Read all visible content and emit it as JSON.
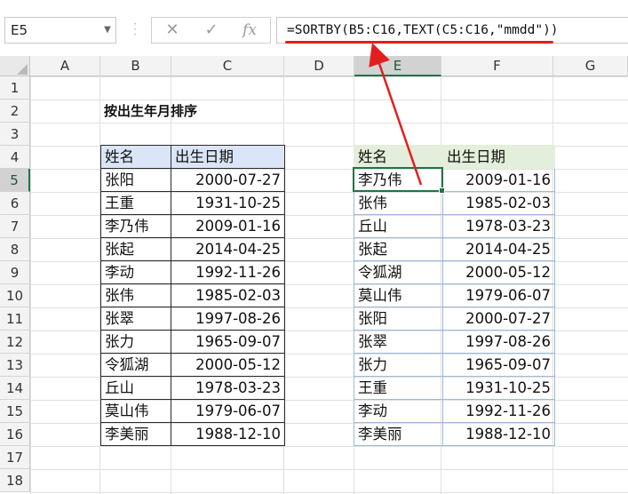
{
  "name_box": "E5",
  "formula": "=SORTBY(B5:C16,TEXT(C5:C16,\"mmdd\"))",
  "formula_icons": [
    "cancel-icon",
    "enter-icon",
    "function-icon"
  ],
  "fx_label": "fx",
  "columns": [
    "A",
    "B",
    "C",
    "D",
    "E",
    "F",
    "G"
  ],
  "rows": [
    "1",
    "2",
    "3",
    "4",
    "5",
    "6",
    "7",
    "8",
    "9",
    "10",
    "11",
    "12",
    "13",
    "14",
    "15",
    "16",
    "17",
    "18"
  ],
  "selected_column": "E",
  "selected_row": "5",
  "sheet_title": "按出生年月排序",
  "left_table": {
    "headers": [
      "姓名",
      "出生日期"
    ],
    "rows": [
      [
        "张阳",
        "2000-07-27"
      ],
      [
        "王重",
        "1931-10-25"
      ],
      [
        "李乃伟",
        "2009-01-16"
      ],
      [
        "张起",
        "2014-04-25"
      ],
      [
        "李动",
        "1992-11-26"
      ],
      [
        "张伟",
        "1985-02-03"
      ],
      [
        "张翠",
        "1997-08-26"
      ],
      [
        "张力",
        "1965-09-07"
      ],
      [
        "令狐湖",
        "2000-05-12"
      ],
      [
        "丘山",
        "1978-03-23"
      ],
      [
        "莫山伟",
        "1979-06-07"
      ],
      [
        "李美丽",
        "1988-12-10"
      ]
    ]
  },
  "right_table": {
    "headers": [
      "姓名",
      "出生日期"
    ],
    "rows": [
      [
        "李乃伟",
        "2009-01-16"
      ],
      [
        "张伟",
        "1985-02-03"
      ],
      [
        "丘山",
        "1978-03-23"
      ],
      [
        "张起",
        "2014-04-25"
      ],
      [
        "令狐湖",
        "2000-05-12"
      ],
      [
        "莫山伟",
        "1979-06-07"
      ],
      [
        "张阳",
        "2000-07-27"
      ],
      [
        "张翠",
        "1997-08-26"
      ],
      [
        "张力",
        "1965-09-07"
      ],
      [
        "王重",
        "1931-10-25"
      ],
      [
        "李动",
        "1992-11-26"
      ],
      [
        "李美丽",
        "1988-12-10"
      ]
    ]
  },
  "colors": {
    "accent": "#217346",
    "annotation": "#e21e1e",
    "left_header_fill": "#dbe5f8",
    "right_header_fill": "#e3efda"
  }
}
